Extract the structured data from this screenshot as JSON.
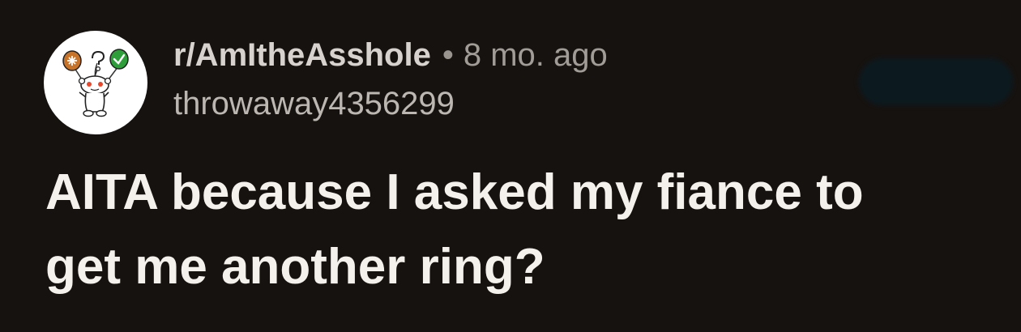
{
  "post": {
    "subreddit": "r/AmItheAsshole",
    "separator": "•",
    "time_ago": "8 mo. ago",
    "username": "throwaway4356299",
    "title_line1": "AITA because I asked my fiance to",
    "title_line2": "get me another ring?",
    "avatar_icon": "reddit-snoo-with-balloons-icon",
    "join_button_icon": "blurred-join-button"
  },
  "colors": {
    "background": "#161210",
    "title": "#f4f0ec",
    "subreddit": "#d7d2cd",
    "meta": "#a29c97",
    "balloon_left": "#c8732a",
    "balloon_right": "#2e9e3a",
    "snoo_eyes": "#e8472b"
  }
}
